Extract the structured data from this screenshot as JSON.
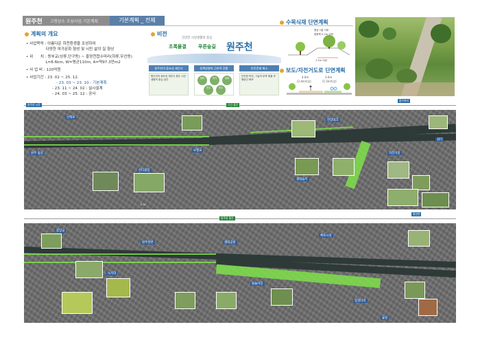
{
  "header": {
    "title": "원주천",
    "subtitle": "고향상소 조성사업 기본계획",
    "tab": "기본계획 _ 전체"
  },
  "overview": {
    "title": "계획의 개요",
    "rows": [
      "• 사업목적 : 아름다운 하천환경을 조성하여",
      "                다양한 여가문화 형성 및 시민 삶의 질 향상",
      "• 위      치 : 동부교(상류,단구동) ~ 흥양천합수머리(하류,우산동)",
      "                L=8.6km, W=평균110m, A=약97.3만m2",
      "• 사 업 비 : 120억원",
      "• 사업기간 : 23. 02 ~ 25. 12."
    ],
    "schedule": [
      "- 23. 03 ~ 23. 10 : 기본계획",
      "- 23. 11 ~ 24. 02 : 실시설계",
      "- 24. 03 ~ 25. 12 : 공사"
    ]
  },
  "vision": {
    "title": "비전",
    "subtitle": "건강한 시민생활의 중심",
    "slogan1": "초록물결",
    "slogan2": "푸른숲길",
    "name": "원주천",
    "boxes": [
      "원주천의 중요성 재인식",
      "정책방향의 근본적 전환",
      "안전문제 해소"
    ],
    "circles": [
      "생태",
      "레크",
      "친수",
      "치수",
      "정비",
      "여가"
    ],
    "col_texts": [
      "원주천의 중요성 재인식 원주 시민생활의 중심 공간",
      "정책방향 생활의 중심으로 친수공간 조성",
      "안전한 하천, 그늘의 부족 해결 보행공간 확보"
    ]
  },
  "section1": {
    "title": "수목식재 단면계획",
    "notes": [
      "형성 1열 식재",
      "중형목 0.2m 이하",
      "1.5m 이상"
    ]
  },
  "section2": {
    "title": "보도/자전거도로 단면계획",
    "labels": [
      "4.0m",
      "3.0m",
      "(2.4m이상)",
      "(1.5m이상)"
    ]
  },
  "tracks": {
    "top_left": "원주천 시작",
    "top_mid": "구간 중간",
    "top_right": "합수머리",
    "mid_mid": "원주천 중간",
    "mid_right": "흥양천"
  },
  "map_labels": {
    "map1": [
      "원주 숲길",
      "산책로",
      "잔디광장",
      "보행교",
      "생태습지",
      "전망데크",
      "자전거길",
      "쉼터"
    ],
    "map2": [
      "중앙교",
      "원주천변",
      "생태공원",
      "체육시설",
      "녹지대",
      "물놀이장",
      "징검다리",
      "꽃길"
    ]
  },
  "colors": {
    "accent_blue": "#2b6ea8",
    "accent_orange": "#e9a12a",
    "green_path": "#7fe04a"
  }
}
